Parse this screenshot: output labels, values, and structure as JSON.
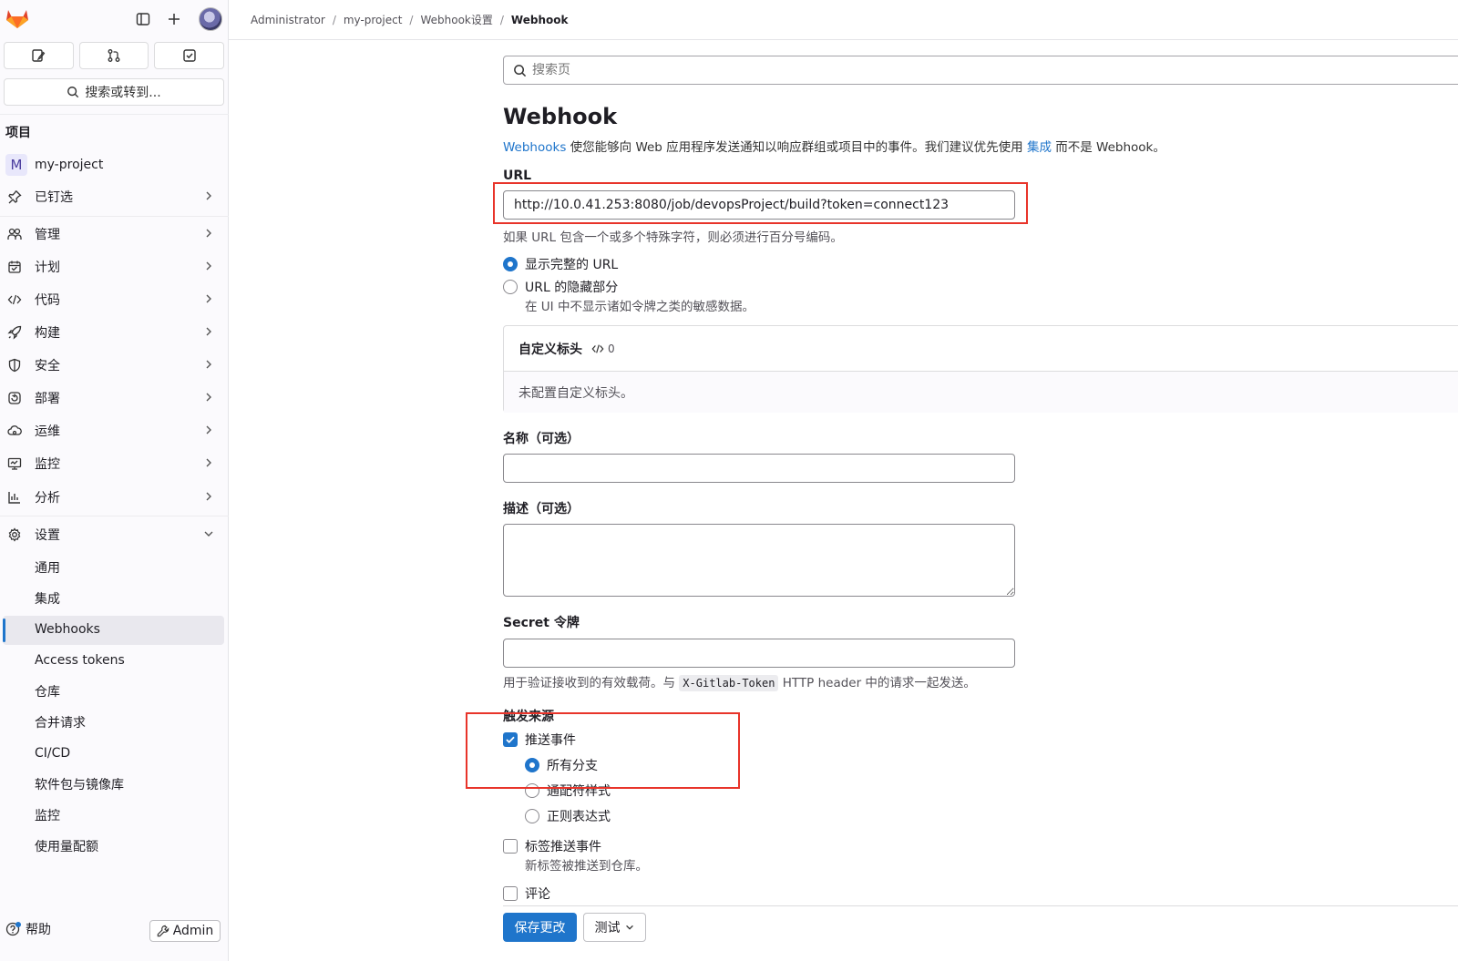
{
  "colors": {
    "accent": "#1f75cb",
    "highlight_box": "#e8342a",
    "sidebar_bg": "#fbfafd"
  },
  "sidebar": {
    "search_label": "搜索或转到...",
    "section_title": "项目",
    "project_initial": "M",
    "project_name": "my-project",
    "nav": [
      {
        "label": "已钉选",
        "icon": "pin-icon"
      },
      {
        "label": "管理",
        "icon": "users-icon"
      },
      {
        "label": "计划",
        "icon": "calendar-icon"
      },
      {
        "label": "代码",
        "icon": "code-icon"
      },
      {
        "label": "构建",
        "icon": "rocket-icon"
      },
      {
        "label": "安全",
        "icon": "shield-icon"
      },
      {
        "label": "部署",
        "icon": "deploy-icon"
      },
      {
        "label": "运维",
        "icon": "cloud-icon"
      },
      {
        "label": "监控",
        "icon": "monitor-icon"
      },
      {
        "label": "分析",
        "icon": "chart-icon"
      },
      {
        "label": "设置",
        "icon": "gear-icon"
      }
    ],
    "settings_items": [
      "通用",
      "集成",
      "Webhooks",
      "Access tokens",
      "仓库",
      "合并请求",
      "CI/CD",
      "软件包与镜像库",
      "监控",
      "使用量配额"
    ],
    "active_item": "Webhooks",
    "help_label": "帮助",
    "admin_label": "Admin"
  },
  "breadcrumb": [
    "Administrator",
    "my-project",
    "Webhook设置",
    "Webhook"
  ],
  "search": {
    "placeholder": "搜索页"
  },
  "page": {
    "title": "Webhook",
    "desc_link1": "Webhooks",
    "desc_text1": " 使您能够向 Web 应用程序发送通知以响应群组或项目中的事件。我们建议优先使用 ",
    "desc_link2": "集成",
    "desc_text2": " 而不是 Webhook。"
  },
  "url": {
    "label": "URL",
    "value": "http://10.0.41.253:8080/job/devopsProject/build?token=connect123",
    "help": "如果 URL 包含一个或多个特殊字符，则必须进行百分号编码。",
    "option_full": "显示完整的 URL",
    "option_masked": "URL 的隐藏部分",
    "option_masked_help": "在 UI 中不显示诸如令牌之类的敏感数据。",
    "selected": "full"
  },
  "custom_headers": {
    "title": "自定义标头",
    "count": "0",
    "empty": "未配置自定义标头。"
  },
  "name": {
    "label": "名称（可选）",
    "value": ""
  },
  "description": {
    "label": "描述（可选）",
    "value": ""
  },
  "secret": {
    "label": "Secret 令牌",
    "value": "",
    "help_before": "用于验证接收到的有效载荷。与 ",
    "help_code": "X-Gitlab-Token",
    "help_after": " HTTP header 中的请求一起发送。"
  },
  "triggers": {
    "label": "触发来源",
    "push": {
      "label": "推送事件",
      "checked": true
    },
    "branch_all": "所有分支",
    "branch_wildcard": "通配符样式",
    "branch_regex": "正则表达式",
    "branch_selected": "all",
    "tag_push": {
      "label": "标签推送事件",
      "help": "新标签被推送到仓库。",
      "checked": false
    },
    "comments": {
      "label": "评论",
      "checked": false
    }
  },
  "actions": {
    "save": "保存更改",
    "test": "测试"
  }
}
